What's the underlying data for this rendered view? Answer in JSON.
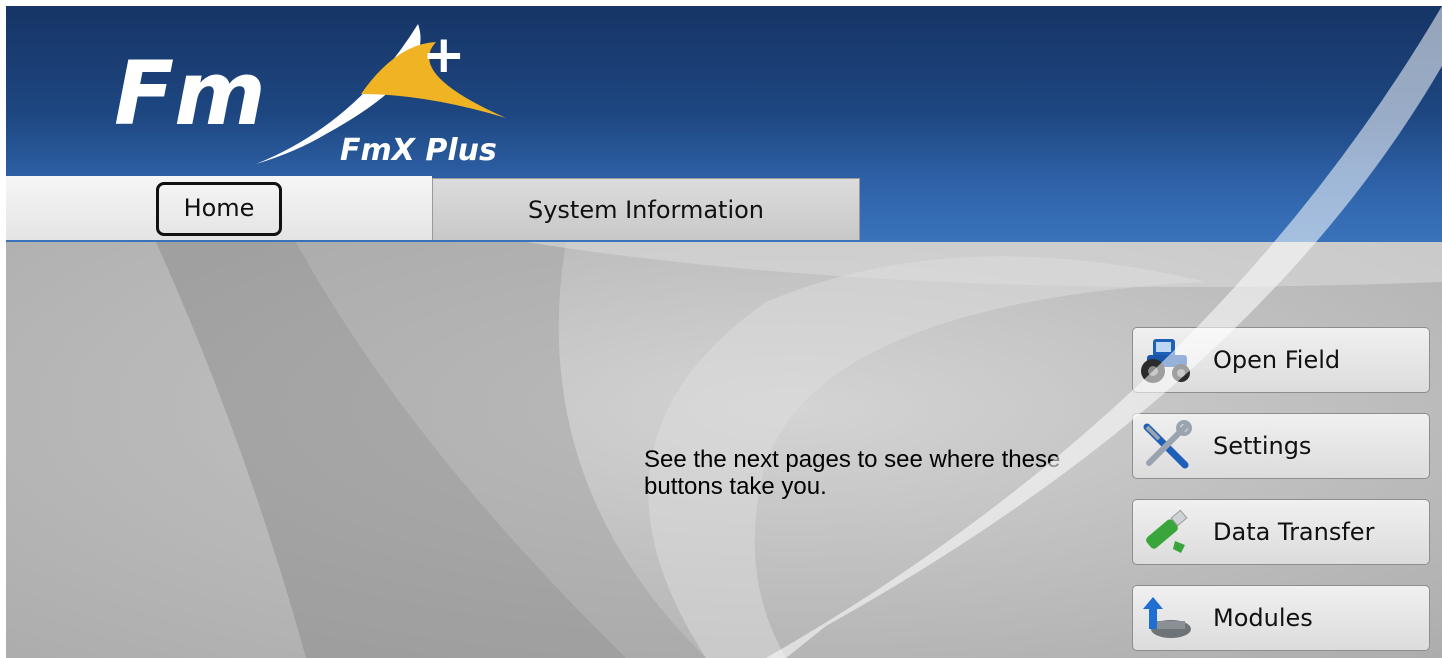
{
  "header": {
    "logo_mark": "Fm",
    "logo_plus": "+",
    "product_name": "FmX Plus"
  },
  "tabs": [
    {
      "label": "Home",
      "active": true
    },
    {
      "label": "System Information",
      "active": false
    }
  ],
  "main": {
    "hint_text": "See the next pages to see where these buttons take you."
  },
  "actions": [
    {
      "label": "Open Field",
      "icon": "tractor-icon"
    },
    {
      "label": "Settings",
      "icon": "wrench-screwdriver-icon"
    },
    {
      "label": "Data Transfer",
      "icon": "usb-drive-icon"
    },
    {
      "label": "Modules",
      "icon": "module-upload-icon"
    }
  ],
  "colors": {
    "header_top": "#163566",
    "header_bottom": "#3a73bb",
    "logo_swoosh": "#f0b323",
    "accent_blue": "#1e5fb8",
    "usb_green": "#3aa53a"
  }
}
